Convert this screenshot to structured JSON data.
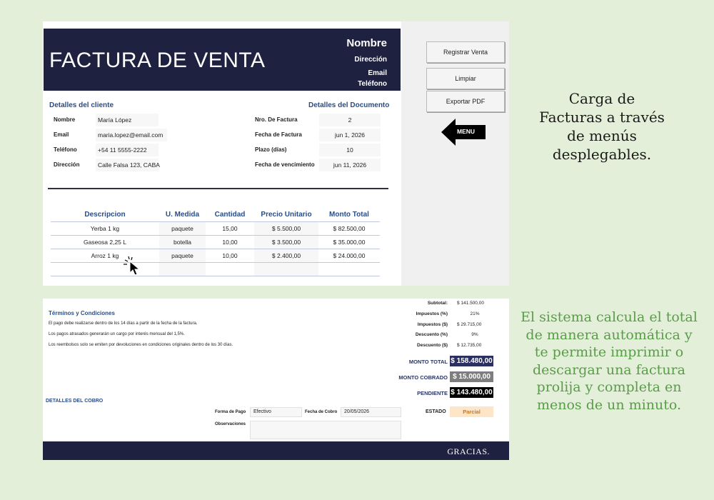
{
  "invoice": {
    "title": "FACTURA DE VENTA",
    "header": {
      "name": "Nombre",
      "address": "Dirección",
      "email": "Email",
      "phone": "Teléfono"
    }
  },
  "actions": {
    "register": "Registrar Venta",
    "clear": "Limpiar",
    "export": "Exportar PDF",
    "menu": "MENU"
  },
  "client": {
    "title": "Detalles del cliente",
    "fields": [
      {
        "label": "Nombre",
        "value": "María López"
      },
      {
        "label": "Email",
        "value": "maria.lopez@email.com"
      },
      {
        "label": "Teléfono",
        "value": "+54 11 5555-2222"
      },
      {
        "label": "Dirección",
        "value": "Calle Falsa 123, CABA"
      }
    ]
  },
  "document": {
    "title": "Detalles del Documento",
    "fields": [
      {
        "label": "Nro. De Factura",
        "value": "2"
      },
      {
        "label": "Fecha de Factura",
        "value": "jun 1, 2026"
      },
      {
        "label": "Plazo (días)",
        "value": "10"
      },
      {
        "label": "Fecha de vencimiento",
        "value": "jun 11, 2026"
      }
    ]
  },
  "items": {
    "headers": [
      "Descripcion",
      "U. Medida",
      "Cantidad",
      "Precio Unitario",
      "Monto Total"
    ],
    "rows": [
      [
        "Yerba 1 kg",
        "paquete",
        "15,00",
        "$ 5.500,00",
        "$ 82.500,00"
      ],
      [
        "Gaseosa 2,25 L",
        "botella",
        "10,00",
        "$ 3.500,00",
        "$ 35.000,00"
      ],
      [
        "Arroz 1 kg",
        "paquete",
        "10,00",
        "$ 2.400,00",
        "$ 24.000,00"
      ]
    ]
  },
  "terms": {
    "title": "Términos y Condiciones",
    "lines": [
      "El pago debe realizarse dentro de los 14 días a partir de la fecha de la factura.",
      "Los pagos atrasados generarán un cargo por interés mensual del 1,5%.",
      "Los reembolsos solo se emiten por devoluciones en condiciones originales dentro de los 30 días."
    ]
  },
  "totals": {
    "subtotal_label": "Subtotal:",
    "subtotal": "$ 141.500,00",
    "tax_pct_label": "Impuestos (%)",
    "tax_pct": "21%",
    "tax_amt_label": "Impuestos ($)",
    "tax_amt": "$ 29.715,00",
    "disc_pct_label": "Descuento (%)",
    "disc_pct": "9%",
    "disc_amt_label": "Descuento ($)",
    "disc_amt": "$ 12.735,00",
    "total_label": "MONTO TOTAL",
    "total": "$ 158.480,00",
    "collected_label": "MONTO COBRADO",
    "collected": "$ 15.000,00",
    "pending_label": "PENDIENTE",
    "pending": "$ 143.480,00"
  },
  "payment": {
    "title": "DETALLES DEL COBRO",
    "method_label": "Forma de Pago",
    "method": "Efectivo",
    "date_label": "Fecha de Cobro",
    "date": "20/05/2026",
    "notes_label": "Observaciones",
    "notes": "",
    "status_label": "ESTADO",
    "status": "Parcial"
  },
  "footer": {
    "thanks": "GRACIAS."
  },
  "promo": {
    "headline": "Carga de Facturas a través de menús desplegables.",
    "body": "El sistema calcula el total de manera automática y te permite imprimir o descargar una factura prolija y completa en menos de un minuto."
  },
  "colors": {
    "navy": "#1e2240",
    "accent_blue": "#2a4d86",
    "background": "#e3efd8",
    "promo_green": "#5a9c4a",
    "status_bg": "#fde6c8"
  },
  "icons": {
    "menu_arrow": "left-arrow-icon",
    "cursor": "pointer-cursor-icon"
  }
}
